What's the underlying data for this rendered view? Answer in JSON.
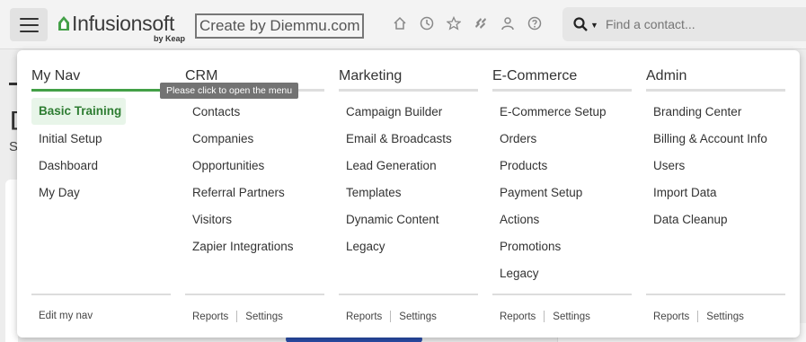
{
  "header": {
    "logo_text": "Infusionsoft",
    "logo_sub": "by Keap",
    "brand_text": "Create by Diemmu.com",
    "brand_color": "#43a047",
    "icons": [
      "home-icon",
      "clock-icon",
      "star-icon",
      "hash-icon",
      "person-icon",
      "help-icon"
    ],
    "search_placeholder": "Find a contact..."
  },
  "tooltip": "Please click to open the menu",
  "menu": {
    "columns": [
      {
        "title": "My Nav",
        "items": [
          "Basic Training",
          "Initial Setup",
          "Dashboard",
          "My Day"
        ],
        "active_item": "Basic Training",
        "footer": [
          "Edit my nav"
        ]
      },
      {
        "title": "CRM",
        "items": [
          "Contacts",
          "Companies",
          "Opportunities",
          "Referral Partners",
          "Visitors",
          "Zapier Integrations"
        ],
        "footer": [
          "Reports",
          "Settings"
        ]
      },
      {
        "title": "Marketing",
        "items": [
          "Campaign Builder",
          "Email & Broadcasts",
          "Lead Generation",
          "Templates",
          "Dynamic Content",
          "Legacy"
        ],
        "footer": [
          "Reports",
          "Settings"
        ]
      },
      {
        "title": "E-Commerce",
        "items": [
          "E-Commerce Setup",
          "Orders",
          "Products",
          "Payment Setup",
          "Actions",
          "Promotions",
          "Legacy"
        ],
        "footer": [
          "Reports",
          "Settings"
        ]
      },
      {
        "title": "Admin",
        "items": [
          "Branding Center",
          "Billing & Account Info",
          "Users",
          "Import Data",
          "Data Cleanup"
        ],
        "footer": [
          "Reports",
          "Settings"
        ]
      }
    ]
  },
  "background": {
    "fragment_heading": "[",
    "fragment_text": "S"
  }
}
